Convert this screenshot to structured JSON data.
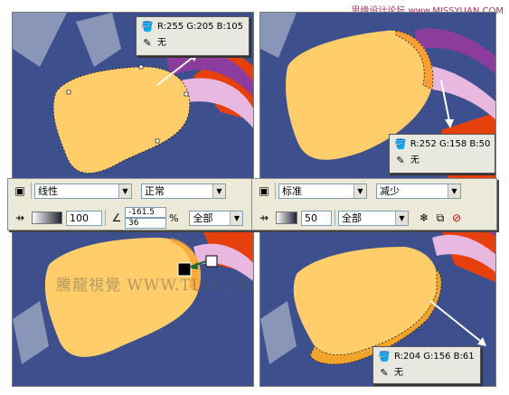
{
  "site_watermark": "思缘设计论坛 www.MISSYUAN.COM",
  "image_watermark": "騰龍視覺 WWW.TLVI.NET",
  "tooltips": {
    "top_left": {
      "color": "R:255 G:205 B:105",
      "outline": "无"
    },
    "top_right": {
      "color": "R:252 G:158 B:50",
      "outline": "无"
    },
    "bottom_right": {
      "color": "R:204 G:156 B:61",
      "outline": "无"
    }
  },
  "toolbar_left": {
    "type": "线性",
    "mode": "正常",
    "opacity": "100",
    "angle": "-161.5",
    "edge": "36",
    "percent_symbol": "%",
    "target": "全部"
  },
  "toolbar_right": {
    "type": "标准",
    "mode": "减少",
    "opacity": "50",
    "target": "全部"
  },
  "colors": {
    "background": "#3d4f8c",
    "shape_fill": "#ffcd69",
    "shape_fill_orange": "#fc9e32",
    "shape_shadow": "#cc9c3d",
    "red_accent": "#e8400c",
    "pink_ribbon": "#e8b8e0",
    "purple_ribbon": "#8c3c9c",
    "gray_hex": "#8a96b8"
  },
  "icons": [
    "fill-bucket-icon",
    "pen-outline-icon",
    "transparency-tool-icon",
    "freeze-icon",
    "copy-transparency-icon",
    "clear-transparency-icon"
  ]
}
